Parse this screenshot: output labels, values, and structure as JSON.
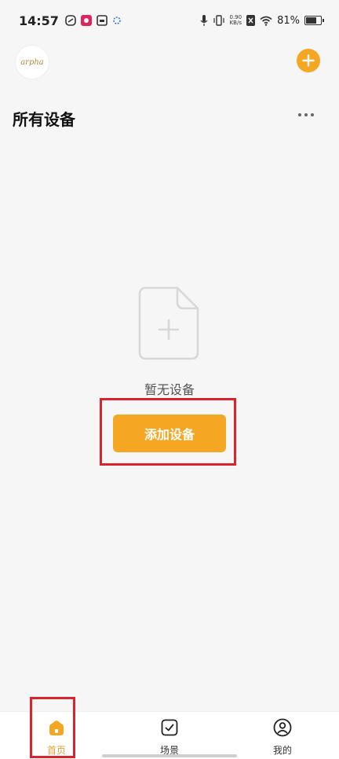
{
  "status_bar": {
    "time": "14:57",
    "net_speed_value": "0.90",
    "net_speed_unit": "KB/s",
    "battery_percent": "81%",
    "battery_level": 0.81,
    "icons": [
      "app-icon-1",
      "app-icon-2",
      "app-icon-3",
      "app-icon-4",
      "mic-icon",
      "vibrate-icon",
      "sim-off-icon",
      "wifi-icon",
      "battery-icon"
    ]
  },
  "header": {
    "avatar_text": "arpha",
    "add_icon": "plus-icon",
    "accent_color": "#f5a623"
  },
  "page": {
    "title": "所有设备",
    "more_icon": "more-dots-icon"
  },
  "empty_state": {
    "icon": "empty-document-icon",
    "text": "暂无设备",
    "button_label": "添加设备"
  },
  "tab_bar": {
    "tabs": [
      {
        "label": "首页",
        "icon": "home-icon",
        "active": true
      },
      {
        "label": "场景",
        "icon": "checkbox-icon",
        "active": false
      },
      {
        "label": "我的",
        "icon": "user-circle-icon",
        "active": false
      }
    ]
  },
  "highlight_color": "#d9232d"
}
